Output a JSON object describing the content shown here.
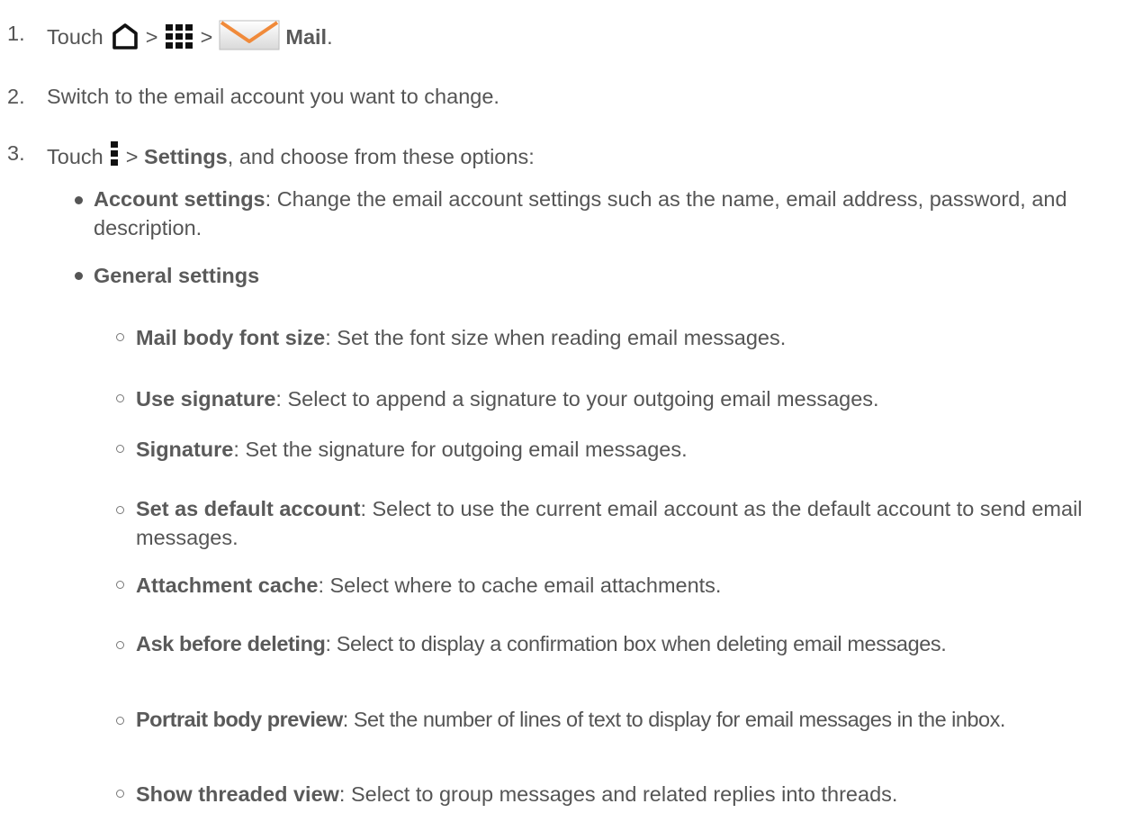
{
  "steps": [
    {
      "num": "1.",
      "touch": "Touch",
      "gt1": ">",
      "gt2": ">",
      "mail_label": "Mail",
      "end": "."
    },
    {
      "num": "2.",
      "text": "Switch to the email account you want to change."
    },
    {
      "num": "3.",
      "touch": "Touch",
      "gt": ">",
      "settings_label": "Settings",
      "rest": ", and choose from these options:"
    }
  ],
  "options": [
    {
      "label": "Account settings",
      "desc": ": Change the email account settings such as the name, email address, password, and description."
    },
    {
      "label": "General settings"
    }
  ],
  "sub_options": [
    {
      "label": "Mail body font size",
      "desc": ": Set the font size when reading email messages."
    },
    {
      "label": "Use signature",
      "desc": ": Select to append a signature to your outgoing email messages."
    },
    {
      "label": "Signature",
      "desc": ": Set the signature for outgoing email messages."
    },
    {
      "label": "Set as default account",
      "desc": ": Select to use the current email account as the default account to send email messages."
    },
    {
      "label": "Attachment cache",
      "desc": ": Select where to cache email attachments."
    },
    {
      "label": "Ask before deleting",
      "desc": ": Select to display a confirmation box when deleting email messages."
    },
    {
      "label": "Portrait body preview",
      "desc": ": Set the number of lines of text to display for email messages in the inbox."
    },
    {
      "label": "Show threaded view",
      "desc": ": Select to group messages and related replies into threads."
    }
  ],
  "icons": {
    "home": "home-icon",
    "apps": "apps-grid-icon",
    "mail": "mail-envelope-icon",
    "menu": "menu-more-icon"
  },
  "colors": {
    "text": "#555555",
    "mail_orange": "#f08a3a"
  }
}
